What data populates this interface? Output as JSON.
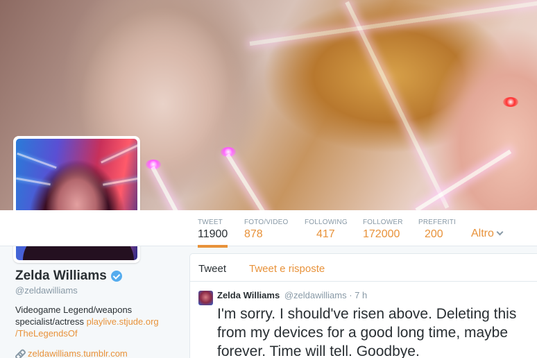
{
  "profile": {
    "name": "Zelda Williams",
    "handle": "@zeldawilliams",
    "bio_text": "Videogame Legend/weapons specialist/actress",
    "bio_link_1": "playlive.stjude.org",
    "bio_link_2": "/TheLegendsOf",
    "website": "zeldawilliams.tumblr.com"
  },
  "stats": [
    {
      "label": "TWEET",
      "value": "11900"
    },
    {
      "label": "FOTO/VIDEO",
      "value": "878"
    },
    {
      "label": "FOLLOWING",
      "value": "417"
    },
    {
      "label": "FOLLOWER",
      "value": "172000"
    },
    {
      "label": "PREFERITI",
      "value": "200"
    }
  ],
  "more_label": "Altro",
  "timeline": {
    "tabs": [
      "Tweet",
      "Tweet e risposte"
    ],
    "tweet": {
      "name": "Zelda Williams",
      "handle": "@zeldawilliams · 7 h",
      "text": "I'm sorry. I should've risen above. Deleting this from my devices for a good long time, maybe forever. Time will tell. Goodbye."
    }
  },
  "colors": {
    "accent": "#e8923a",
    "verified": "#55acee",
    "text": "#292f33",
    "muted": "#8899a6"
  },
  "icons": [
    "verified-badge-icon",
    "link-icon",
    "chevron-down-icon"
  ]
}
